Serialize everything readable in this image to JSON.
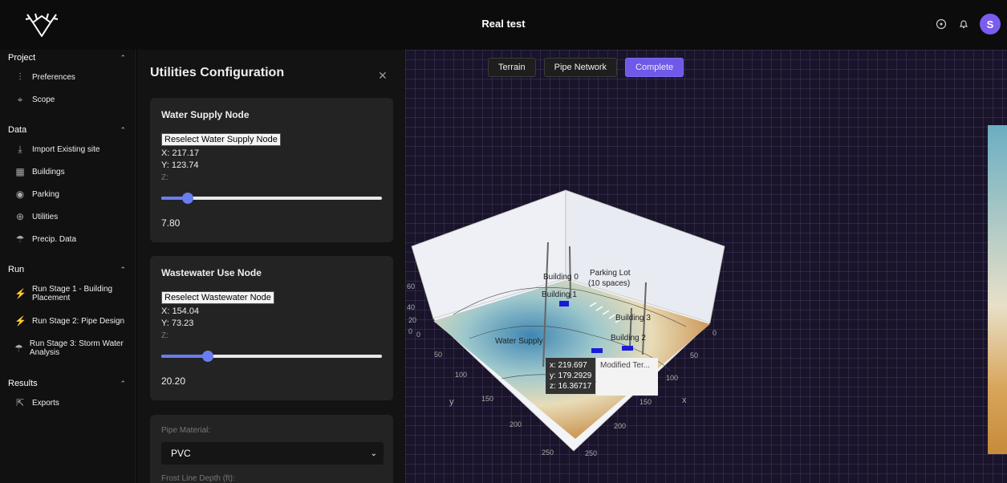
{
  "app": {
    "title": "Real test",
    "avatar_initial": "S"
  },
  "icons": {
    "logo": "antler-logo-icon",
    "help": "help-icon",
    "notifications": "bell-icon"
  },
  "sidebar": {
    "sections": [
      {
        "label": "Project",
        "items": [
          "Preferences",
          "Scope"
        ]
      },
      {
        "label": "Data",
        "items": [
          "Import Existing site",
          "Buildings",
          "Parking",
          "Utilities",
          "Precip. Data"
        ]
      },
      {
        "label": "Run",
        "items": [
          "Run Stage 1 - Building Placement",
          "Run Stage 2: Pipe Design",
          "Run Stage 3: Storm Water Analysis"
        ]
      },
      {
        "label": "Results",
        "items": [
          "Exports"
        ]
      }
    ],
    "active_item": "Run Stage 2: Pipe Design"
  },
  "panel": {
    "title": "Utilities Configuration",
    "water_supply": {
      "title": "Water Supply Node",
      "button": "Reselect Water Supply Node",
      "x": "X: 217.17",
      "y": "Y: 123.74",
      "z_label": "Z:",
      "z_value": "7.80",
      "slider_fraction": 0.12
    },
    "wastewater": {
      "title": "Wastewater Use Node",
      "button": "Reselect Wastewater Node",
      "x": "X: 154.04",
      "y": "Y: 73.23",
      "z_label": "Z:",
      "z_value": "20.20",
      "slider_fraction": 0.21
    },
    "pipe": {
      "material_label": "Pipe Material:",
      "material_value": "PVC",
      "frost_label": "Frost Line Depth (ft):"
    }
  },
  "view": {
    "tabs": [
      "Terrain",
      "Pipe Network",
      "Complete"
    ],
    "active_tab": "Complete",
    "labels": {
      "building0": "Building 0",
      "building1": "Building 1",
      "building2": "Building 2",
      "building3": "Building 3",
      "parking": "Parking Lot",
      "parking_sub": "(10 spaces)",
      "water": "Water Supply"
    },
    "tooltip": {
      "x": "x: 219.697",
      "y": "y: 179.2929",
      "z": "z: 16.36717",
      "trace": "Modified Ter..."
    },
    "axis": {
      "x_label": "x",
      "y_label": "y",
      "y_ticks": [
        "0",
        "50",
        "100",
        "150",
        "200",
        "250"
      ],
      "x_ticks": [
        "0",
        "50",
        "100",
        "150",
        "200",
        "250"
      ],
      "z_ticks": [
        "0",
        "20",
        "40",
        "60"
      ]
    }
  }
}
